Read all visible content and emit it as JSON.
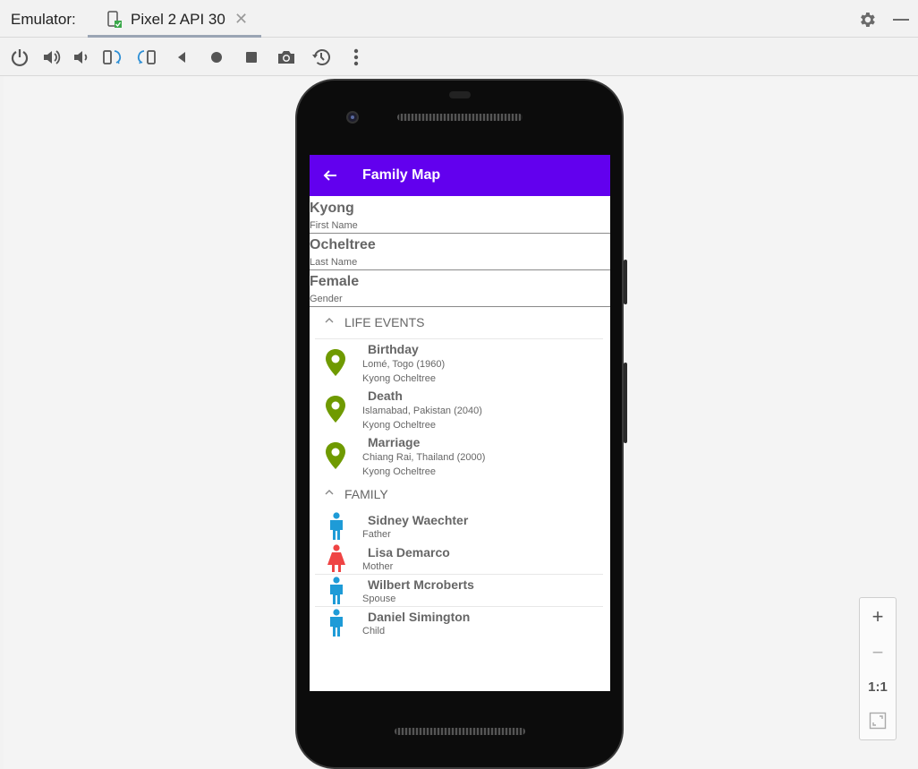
{
  "window": {
    "emulator_label": "Emulator:",
    "tab_label": "Pixel 2 API 30",
    "tab_close": "✕"
  },
  "toolbar": {
    "icons": [
      "power-icon",
      "volume-up-icon",
      "volume-down-icon",
      "rotate-left-icon",
      "rotate-right-icon",
      "back-icon",
      "home-icon",
      "overview-icon",
      "camera-icon",
      "snapshot-icon",
      "more-icon"
    ]
  },
  "app": {
    "title": "Family Map",
    "appbar_color": "#6200ee",
    "fields": [
      {
        "value": "Kyong",
        "label": "First Name"
      },
      {
        "value": "Ocheltree",
        "label": "Last Name"
      },
      {
        "value": "Female",
        "label": "Gender"
      }
    ],
    "life_events": {
      "title": "LIFE EVENTS",
      "items": [
        {
          "title": "Birthday",
          "location": "Lomé, Togo (1960)",
          "person": "Kyong Ocheltree"
        },
        {
          "title": "Death",
          "location": "Islamabad, Pakistan (2040)",
          "person": "Kyong Ocheltree"
        },
        {
          "title": "Marriage",
          "location": "Chiang Rai, Thailand (2000)",
          "person": "Kyong Ocheltree"
        }
      ],
      "pin_color": "#6f9a00"
    },
    "family": {
      "title": "FAMILY",
      "items": [
        {
          "name": "Sidney Waechter",
          "relation": "Father",
          "gender": "male"
        },
        {
          "name": "Lisa Demarco",
          "relation": "Mother",
          "gender": "female"
        },
        {
          "name": "Wilbert Mcroberts",
          "relation": "Spouse",
          "gender": "male"
        },
        {
          "name": "Daniel Simington",
          "relation": "Child",
          "gender": "male"
        }
      ],
      "male_color": "#1e9bd7",
      "female_color": "#ef4444"
    }
  },
  "zoom": {
    "plus": "+",
    "minus": "−",
    "one_to_one": "1:1"
  }
}
